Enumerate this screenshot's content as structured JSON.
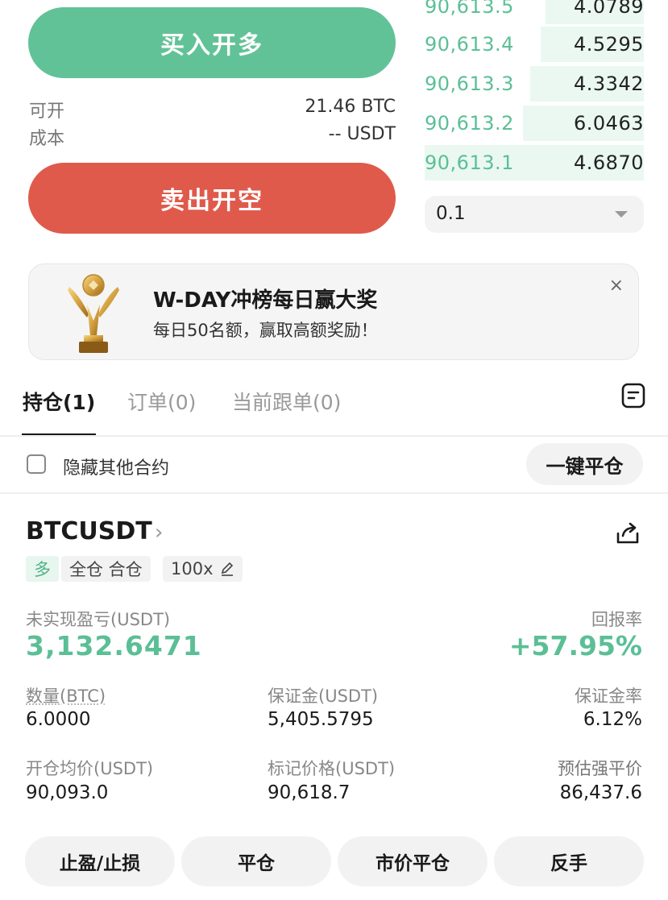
{
  "orderbook": {
    "rows": [
      {
        "price": "90,613.5",
        "size": "4.0789",
        "depth": 0.45
      },
      {
        "price": "90,613.4",
        "size": "4.5295",
        "depth": 0.47
      },
      {
        "price": "90,613.3",
        "size": "4.3342",
        "depth": 0.52
      },
      {
        "price": "90,613.2",
        "size": "6.0463",
        "depth": 0.55
      },
      {
        "price": "90,613.1",
        "size": "4.6870",
        "depth": 1.0
      }
    ],
    "precision": "0.1"
  },
  "trade": {
    "buy_label": "买入开多",
    "sell_label": "卖出开空",
    "available_label": "可开",
    "available_value": "21.46 BTC",
    "cost_label": "成本",
    "cost_value": "-- USDT"
  },
  "banner": {
    "title": "W-DAY冲榜每日赢大奖",
    "subtitle": "每日50名额，赢取高额奖励！",
    "close": "×"
  },
  "tabs": [
    {
      "label": "持仓(1)",
      "active": true
    },
    {
      "label": "订单(0)",
      "active": false
    },
    {
      "label": "当前跟单(0)",
      "active": false
    }
  ],
  "filter": {
    "hide_label": "隐藏其他合约",
    "close_all": "一键平仓"
  },
  "position": {
    "symbol": "BTCUSDT",
    "side": "多",
    "mode": "全仓 合仓",
    "leverage": "100x",
    "pnl_label": "未实现盈亏(USDT)",
    "pnl_value": "3,132.6471",
    "roe_label": "回报率",
    "roe_value": "+57.95%",
    "qty_label": "数量(BTC)",
    "qty_value": "6.0000",
    "margin_label": "保证金(USDT)",
    "margin_value": "5,405.5795",
    "margin_rate_label": "保证金率",
    "margin_rate_value": "6.12%",
    "entry_label": "开仓均价(USDT)",
    "entry_value": "90,093.0",
    "mark_label": "标记价格(USDT)",
    "mark_value": "90,618.7",
    "liq_label": "预估强平价",
    "liq_value": "86,437.6"
  },
  "actions": [
    "止盈/止损",
    "平仓",
    "市价平仓",
    "反手"
  ],
  "colors": {
    "green": "#62c297",
    "red": "#e05a4b"
  }
}
